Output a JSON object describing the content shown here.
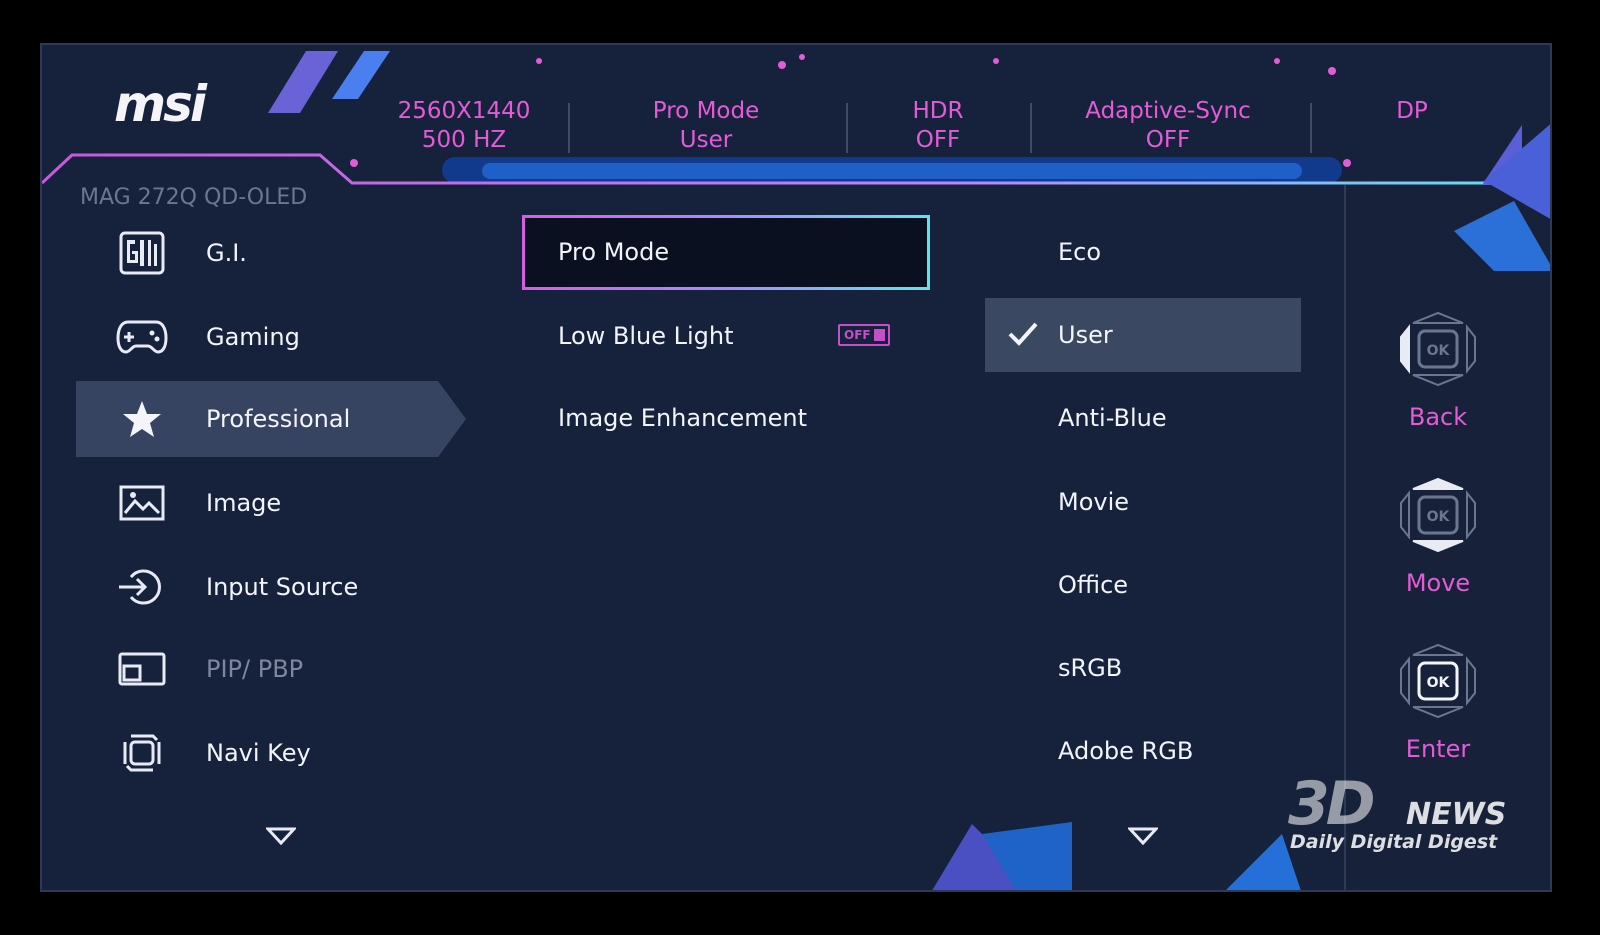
{
  "brand": {
    "logo_text": "msi",
    "model": "MAG 272Q QD-OLED"
  },
  "header": {
    "resolution": {
      "line1": "2560X1440",
      "line2": "500 HZ"
    },
    "pro_mode": {
      "line1": "Pro Mode",
      "line2": "User"
    },
    "hdr": {
      "line1": "HDR",
      "line2": "OFF"
    },
    "adaptive_sync": {
      "line1": "Adaptive-Sync",
      "line2": "OFF"
    },
    "input": {
      "line1": "DP"
    }
  },
  "menu": {
    "items": [
      {
        "label": "G.I.",
        "icon": "gi-icon"
      },
      {
        "label": "Gaming",
        "icon": "gamepad-icon"
      },
      {
        "label": "Professional",
        "icon": "star-icon",
        "active": true
      },
      {
        "label": "Image",
        "icon": "image-icon"
      },
      {
        "label": "Input Source",
        "icon": "input-source-icon"
      },
      {
        "label": "PIP/ PBP",
        "icon": "pip-icon",
        "disabled": true
      },
      {
        "label": "Navi Key",
        "icon": "navi-key-icon"
      }
    ]
  },
  "submenu": {
    "items": [
      {
        "label": "Pro Mode",
        "selected": true
      },
      {
        "label": "Low Blue Light",
        "toggle": "OFF"
      },
      {
        "label": "Image Enhancement"
      }
    ]
  },
  "options": {
    "items": [
      {
        "label": "Eco"
      },
      {
        "label": "User",
        "checked": true
      },
      {
        "label": "Anti-Blue"
      },
      {
        "label": "Movie"
      },
      {
        "label": "Office"
      },
      {
        "label": "sRGB"
      },
      {
        "label": "Adobe RGB"
      }
    ]
  },
  "keys": {
    "ok_text": "OK",
    "back": "Back",
    "move": "Move",
    "enter": "Enter"
  },
  "watermark": {
    "logo": "3D",
    "news": "NEWS",
    "tagline": "Daily Digital Digest"
  },
  "colors": {
    "background": "#16223c",
    "accent_magenta": "#e35bd7",
    "accent_cyan": "#5fe4ee",
    "highlight_row": "#3b4862"
  }
}
